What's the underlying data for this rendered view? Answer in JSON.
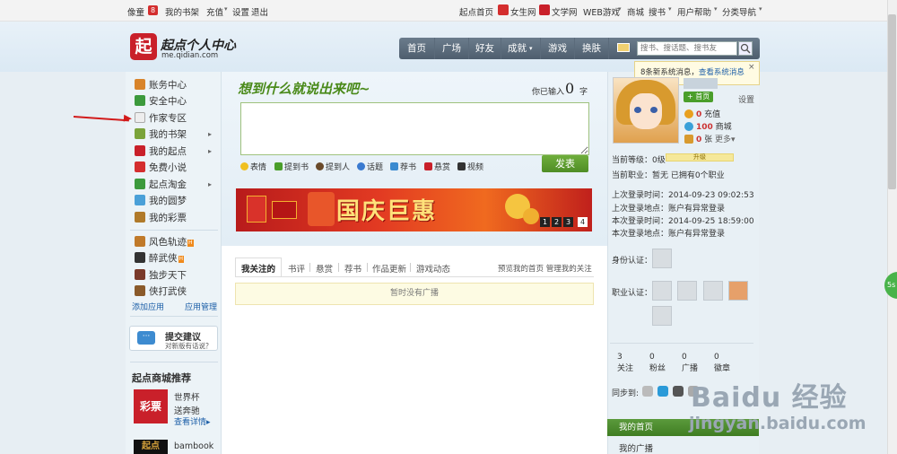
{
  "topbar": {
    "left": {
      "user": "像童",
      "bookshelf": "我的书架",
      "mail_count": "8",
      "recharge": "充值",
      "settings": "设置",
      "logout": "退出"
    },
    "right": {
      "home": "起点首页",
      "female": "女生网",
      "literature": "文学网",
      "webgame": "WEB游戏",
      "mall": "商城",
      "books": "搜书",
      "help": "用户帮助",
      "category": "分类导航"
    }
  },
  "header": {
    "logo_mark": "起",
    "logo_title": "起点个人中心",
    "logo_url": "me.qidian.com",
    "nav": [
      "首页",
      "广场",
      "好友",
      "成就",
      "游戏",
      "换肤"
    ],
    "search_placeholder": "搜书、搜话题、搜书友"
  },
  "sysmsg": {
    "text": "8条新系统消息，",
    "link": "查看系统消息",
    "close": "×"
  },
  "sidebar": {
    "items": [
      {
        "label": "账务中心",
        "color": "#d8842a"
      },
      {
        "label": "安全中心",
        "color": "#3c9a3c"
      },
      {
        "label": "作家专区",
        "color": "#e6e6e6"
      },
      {
        "label": "我的书架",
        "color": "#7aa33a",
        "arrow": "▸"
      },
      {
        "label": "我的起点",
        "color": "#c9202a",
        "arrow": "▸"
      },
      {
        "label": "免费小说",
        "color": "#d42e2e"
      },
      {
        "label": "起点淘金",
        "color": "#3c9a3c",
        "arrow": "▸"
      },
      {
        "label": "我的圆梦",
        "color": "#4aa0d8"
      },
      {
        "label": "我的彩票",
        "color": "#b07a2a"
      }
    ],
    "games": [
      {
        "label": "风色轨迹",
        "hot": "H"
      },
      {
        "label": "醉武侠",
        "hot": "H"
      },
      {
        "label": "独步天下"
      },
      {
        "label": "侠打武侠"
      }
    ],
    "add_app": "添加应用",
    "manage_app": "应用管理",
    "suggest_title": "提交建议",
    "suggest_sub": "对新版有话说？",
    "store_title": "起点商城推荐",
    "store_items": [
      {
        "img": "彩票",
        "title": "世界杯",
        "sub": "送奔驰",
        "link": "查看详情▸"
      },
      {
        "img": "起点",
        "title": "bambook"
      }
    ]
  },
  "post": {
    "slogan": "想到什么就说出来吧~",
    "count_label": "你已输入",
    "count": "0",
    "count_unit": "字",
    "tools": [
      "表情",
      "提到书",
      "提到人",
      "话题",
      "荐书",
      "悬赏",
      "视频"
    ],
    "publish": "发表"
  },
  "banner": {
    "text": "国庆巨惠",
    "pages": [
      "1",
      "2",
      "3",
      "4"
    ]
  },
  "feed": {
    "tabs": [
      "我关注的",
      "书评",
      "悬赏",
      "荐书",
      "作品更新",
      "游戏动态"
    ],
    "right": "预览我的首页 管理我的关注",
    "empty": "暂时没有广播"
  },
  "profile": {
    "follow": "+ 首页",
    "settings": "设置",
    "recharge": {
      "value": "0",
      "label": "充值"
    },
    "mall": {
      "value": "100",
      "label": "商城"
    },
    "tickets": {
      "value": "0",
      "label": "张",
      "more": "更多▾"
    },
    "level_label": "当前等级：",
    "level_value": "0级",
    "level_bar": "升级",
    "job_label": "当前职业：",
    "job_value": "暂无 已拥有0个职业",
    "last_login_time_label": "上次登录时间：",
    "last_login_time": "2014-09-23 09:02:53",
    "last_login_place_label": "上次登录地点：",
    "last_login_place": "账户有异常登录",
    "this_login_time_label": "本次登录时间：",
    "this_login_time": "2014-09-25 18:59:00",
    "this_login_place_label": "本次登录地点：",
    "this_login_place": "账户有异常登录",
    "id_auth_label": "身份认证：",
    "job_auth_label": "职业认证：",
    "counts": [
      {
        "value": "3",
        "label": "关注"
      },
      {
        "value": "0",
        "label": "粉丝"
      },
      {
        "value": "0",
        "label": "广播"
      },
      {
        "value": "0",
        "label": "徽章"
      }
    ],
    "sync_label": "同步到:",
    "my_home": "我的首页",
    "my_broadcast": "我的广播"
  },
  "side_bubble": "5s",
  "watermark": {
    "line1": "Baidu 经验",
    "line2": "jingyan.baidu.com"
  }
}
